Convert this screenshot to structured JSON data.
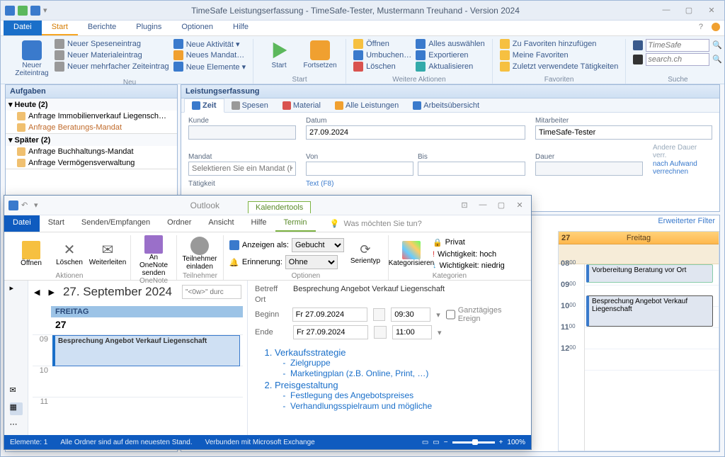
{
  "timesafe": {
    "title": "TimeSafe Leistungserfassung - TimeSafe-Tester, Mustermann Treuhand - Version 2024",
    "menubar": {
      "file": "Datei",
      "start": "Start",
      "berichte": "Berichte",
      "plugins": "Plugins",
      "optionen": "Optionen",
      "hilfe": "Hilfe"
    },
    "ribbon": {
      "neu": {
        "label": "Neu",
        "big": "Neuer\nZeiteintrag",
        "col1": {
          "a": "Neuer Speseneintrag",
          "b": "Neuer Materialeintrag",
          "c": "Neuer mehrfacher Zeiteintrag"
        },
        "col2": {
          "a": "Neue Aktivität ▾",
          "b": "Neues Mandat…",
          "c": "Neue Elemente ▾"
        }
      },
      "startgrp": {
        "label": "Start",
        "start": "Start",
        "fort": "Fortsetzen"
      },
      "weitere": {
        "label": "Weitere Aktionen",
        "col1": {
          "a": "Öffnen",
          "b": "Umbuchen…",
          "c": "Löschen"
        },
        "col2": {
          "a": "Alles auswählen",
          "b": "Exportieren",
          "c": "Aktualisieren"
        }
      },
      "fav": {
        "label": "Favoriten",
        "a": "Zu Favoriten hinzufügen",
        "b": "Meine Favoriten",
        "c": "Zuletzt verwendete Tätigkeiten"
      },
      "suche": {
        "label": "Suche",
        "a_ph": "TimeSafe",
        "b_ph": "search.ch"
      }
    },
    "tasks": {
      "hdr": "Aufgaben",
      "heute": "Heute (2)",
      "heute_items": {
        "a": "Anfrage Immobilienverkauf Liegensch…",
        "b": "Anfrage Beratungs-Mandat"
      },
      "spaeter": "Später (2)",
      "spaeter_items": {
        "a": "Anfrage Buchhaltungs-Mandat",
        "b": "Anfrage Vermögensverwaltung"
      }
    },
    "panel": {
      "title": "Leistungserfassung",
      "tabs": {
        "zeit": "Zeit",
        "spesen": "Spesen",
        "material": "Material",
        "alle": "Alle Leistungen",
        "au": "Arbeitsübersicht"
      },
      "form": {
        "kunde_l": "Kunde",
        "datum_l": "Datum",
        "datum_v": "27.09.2024",
        "ma_l": "Mitarbeiter",
        "ma_v": "TimeSafe-Tester",
        "mandat_l": "Mandat",
        "mandat_ph": "Selektieren Sie ein Mandat (Kunde / Mandat)…",
        "von_l": "Von",
        "bis_l": "Bis",
        "dauer_l": "Dauer",
        "andere": "Andere Dauer verr.",
        "aufwand": "nach Aufwand verrechnen",
        "taetigkeit_l": "Tätigkeit",
        "text_l": "Text (F8)"
      }
    },
    "cal": {
      "filter": "Erweiterter Filter",
      "daynum": "27",
      "dayname": "Freitag",
      "hours": {
        "h8": "08",
        "h9": "09",
        "h10": "10",
        "h11": "11",
        "h12": "12",
        "min": "00"
      },
      "evt1": "Vorbereitung Beratung vor Ort",
      "evt2": "Besprechung Angebot Verkauf Liegenschaft"
    }
  },
  "outlook": {
    "titlebar": {
      "app": "Outlook",
      "tools": "Kalendertools"
    },
    "menubar": {
      "file": "Datei",
      "start": "Start",
      "send": "Senden/Empfangen",
      "ordner": "Ordner",
      "ansicht": "Ansicht",
      "hilfe": "Hilfe",
      "termin": "Termin",
      "tell": "Was möchten Sie tun?"
    },
    "ribbon": {
      "aktionen": {
        "label": "Aktionen",
        "open": "Öffnen",
        "del": "Löschen",
        "fwd": "Weiterleiten"
      },
      "onenote": {
        "label": "OneNote",
        "btn": "An OneNote senden"
      },
      "teiln": {
        "label": "Teilnehmer",
        "btn": "Teilnehmer einladen"
      },
      "optionen": {
        "label": "Optionen",
        "anzeigen": "Anzeigen als:",
        "anzeigen_v": "Gebucht",
        "erinn": "Erinnerung:",
        "erinn_v": "Ohne",
        "serie": "Serientyp"
      },
      "kateg": {
        "label": "Kategorien",
        "kategor": "Kategorisieren",
        "privat": "Privat",
        "hoch": "Wichtigkeit: hoch",
        "niedrig": "Wichtigkeit: niedrig"
      }
    },
    "left": {
      "date": "27. September 2024",
      "search_ph": "\"<0w>\" durc",
      "dayname": "FREITAG",
      "daynum": "27",
      "h9": "09",
      "h10": "10",
      "h11": "11",
      "evt": "Besprechung Angebot Verkauf Liegenschaft"
    },
    "detail": {
      "betreff_l": "Betreff",
      "betreff_v": "Besprechung Angebot Verkauf Liegenschaft",
      "ort_l": "Ort",
      "beginn_l": "Beginn",
      "beginn_d": "Fr 27.09.2024",
      "beginn_t": "09:30",
      "ende_l": "Ende",
      "ende_d": "Fr 27.09.2024",
      "ende_t": "11:00",
      "ganz": "Ganztägiges Ereign",
      "body": {
        "i1": "Verkaufsstrategie",
        "i1a": "Zielgruppe",
        "i1b": "Marketingplan (z.B. Online, Print, …)",
        "i2": "Preisgestaltung",
        "i2a": "Festlegung des Angebotspreises",
        "i2b": "Verhandlungsspielraum und mögliche"
      }
    },
    "status": {
      "el": "Elemente: 1",
      "sync": "Alle Ordner sind auf dem neuesten Stand.",
      "conn": "Verbunden mit Microsoft Exchange",
      "zoom": "100%"
    }
  }
}
